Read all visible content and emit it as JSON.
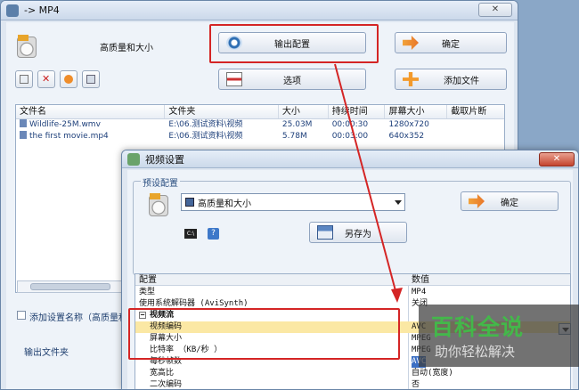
{
  "main": {
    "title": "-> MP4",
    "profile_label": "高质量和大小",
    "buttons": {
      "output_config": "输出配置",
      "ok": "确定",
      "options": "选项",
      "add_files": "添加文件"
    },
    "table": {
      "columns": [
        "文件名",
        "文件夹",
        "大小",
        "持续时间",
        "屏幕大小",
        "截取片断"
      ],
      "rows": [
        [
          "Wildlife-25M.wmv",
          "E:\\06.测试资料\\视频",
          "25.03M",
          "00:00:30",
          "1280x720",
          ""
        ],
        [
          "the first movie.mp4",
          "E:\\06.测试资料\\视频",
          "5.78M",
          "00:03:00",
          "640x352",
          ""
        ]
      ]
    },
    "add_setting_name": "添加设置名称（高质量和",
    "output_folder": "输出文件夹"
  },
  "dialog": {
    "title": "视频设置",
    "preset_group": "预设配置",
    "preset_value": "高质量和大小",
    "ok": "确定",
    "save_as": "另存为",
    "grid": {
      "header_key": "配置",
      "header_value": "数值",
      "rows": [
        {
          "k": "类型",
          "v": "MP4",
          "kind": "top"
        },
        {
          "k": "使用系统解码器 (AviSynth)",
          "v": "关闭",
          "kind": "top"
        },
        {
          "k": "视频流",
          "v": "",
          "kind": "cat"
        },
        {
          "k": "视频编码",
          "v": "AVC",
          "kind": "sel"
        },
        {
          "k": "屏幕大小",
          "v": "MPEG",
          "kind": "item"
        },
        {
          "k": "比特率 （KB/秒 ）",
          "v": "MPEG",
          "kind": "item"
        },
        {
          "k": "每秒帧数",
          "v": "AVC",
          "kind": "item"
        },
        {
          "k": "宽高比",
          "v": "自动(宽度)",
          "kind": "item"
        },
        {
          "k": "二次编码",
          "v": "否",
          "kind": "item"
        }
      ]
    }
  },
  "watermark": {
    "title": "百科全说",
    "subtitle": "助你轻松解决"
  }
}
